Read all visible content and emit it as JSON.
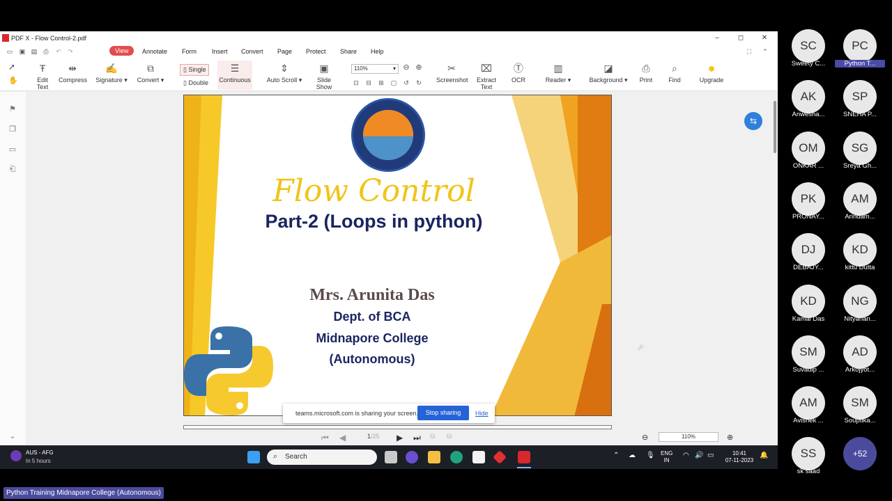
{
  "window": {
    "title": "PDF X - Flow Control-2.pdf",
    "controls": {
      "minimize": "–",
      "maximize": "◻",
      "close": "✕"
    }
  },
  "menu": {
    "items": [
      "View",
      "Annotate",
      "Form",
      "Insert",
      "Convert",
      "Page",
      "Protect",
      "Share",
      "Help"
    ],
    "active": "View"
  },
  "toolbar": {
    "edit_text": "Edit Text",
    "compress": "Compress",
    "signature": "Signature",
    "convert": "Convert",
    "single": "Single",
    "double": "Double",
    "continuous": "Continuous",
    "auto_scroll": "Auto Scroll",
    "slide_show": "Slide Show",
    "zoom": "110%",
    "screenshot": "Screenshot",
    "extract_text": "Extract Text",
    "ocr": "OCR",
    "reader": "Reader",
    "background": "Background",
    "print": "Print",
    "find": "Find",
    "upgrade": "Upgrade"
  },
  "slide": {
    "logo_text": "MIDNAPORE COLLEGE WEST BENGAL · ESTD. 1873",
    "title": "Flow Control",
    "subtitle": "Part-2 (Loops in python)",
    "author": "Mrs. Arunita Das",
    "line1": "Dept. of BCA",
    "line2": "Midnapore College",
    "line3": "(Autonomous)"
  },
  "nav": {
    "page_current": "1",
    "page_total": "/25",
    "zoom": "110%"
  },
  "share_banner": {
    "message": "teams.microsoft.com is sharing your screen.",
    "stop_label": "Stop sharing",
    "hide_label": "Hide"
  },
  "taskbar": {
    "weather_title": "AUS - AFG",
    "weather_sub": "In 5 hours",
    "search_placeholder": "Search",
    "lang1": "ENG",
    "lang2": "IN",
    "time": "10:41",
    "date": "07-11-2023"
  },
  "participants": [
    {
      "initials": "SC",
      "name": "Sweety C..."
    },
    {
      "initials": "PC",
      "name": "Python T..."
    },
    {
      "initials": "AK",
      "name": "Anwesha..."
    },
    {
      "initials": "SP",
      "name": "SNEHA P..."
    },
    {
      "initials": "OM",
      "name": "ONKAR ..."
    },
    {
      "initials": "SG",
      "name": "Sreya Gh..."
    },
    {
      "initials": "PK",
      "name": "PRONAY..."
    },
    {
      "initials": "AM",
      "name": "Arindam..."
    },
    {
      "initials": "DJ",
      "name": "DEBAJY..."
    },
    {
      "initials": "KD",
      "name": "kittu Dutta"
    },
    {
      "initials": "KD",
      "name": "Kamal Das"
    },
    {
      "initials": "NG",
      "name": "Nityanan..."
    },
    {
      "initials": "SM",
      "name": "Suvadip ..."
    },
    {
      "initials": "AD",
      "name": "Arkojyot..."
    },
    {
      "initials": "AM",
      "name": "Avishek ..."
    },
    {
      "initials": "SM",
      "name": "Souptika..."
    },
    {
      "initials": "SS",
      "name": "sk saad"
    },
    {
      "initials": "+52",
      "name": ""
    }
  ],
  "meeting_label": "Python Training Midnapore College (Autonomous)",
  "colors": {
    "accent_red": "#e34d4d",
    "teams_purple": "#4b4b9e",
    "slide_title_gold": "#f0c419",
    "slide_navy": "#1a2560"
  }
}
